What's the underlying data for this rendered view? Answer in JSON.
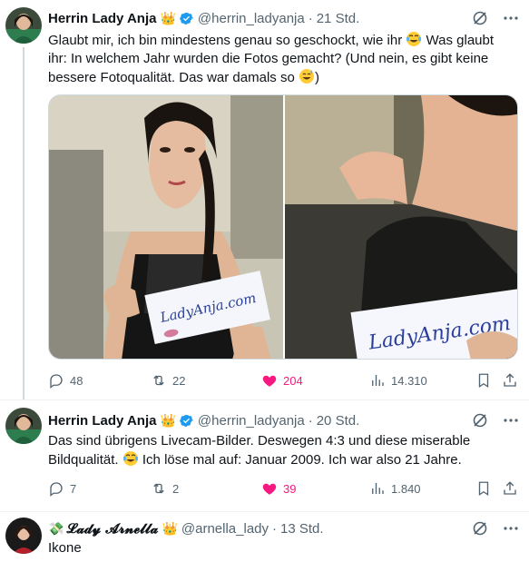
{
  "tweets": [
    {
      "author": "Herrin Lady Anja",
      "crown": "👑",
      "handle": "@herrin_ladyanja",
      "dot": "·",
      "time": "21 Std.",
      "text_part1": "Glaubt mir, ich bin mindestens genau so geschockt, wie ihr ",
      "text_part2": " Was glaubt ihr: In welchem Jahr wurden die Fotos gemacht? (Und nein, es gibt keine bessere Fotoqualität. Das war damals so ",
      "text_part3": ")",
      "media": [
        {
          "alt_icon": "photo-woman-with-ladyanja-sign-1",
          "sign_text": "LadyAnja.com"
        },
        {
          "alt_icon": "photo-woman-with-ladyanja-sign-2",
          "sign_text": "LadyAnja.com"
        }
      ],
      "replies": "48",
      "reposts": "22",
      "likes": "204",
      "views": "14.310"
    },
    {
      "author": "Herrin Lady Anja",
      "crown": "👑",
      "handle": "@herrin_ladyanja",
      "dot": "·",
      "time": "20 Std.",
      "text_part1": "Das sind übrigens Livecam-Bilder. Deswegen 4:3 und diese miserable Bildqualität. ",
      "text_part2": " Ich löse mal auf: Januar 2009. Ich war also 21 Jahre.",
      "replies": "7",
      "reposts": "2",
      "likes": "39",
      "views": "1.840"
    },
    {
      "author_prefix": "💸",
      "author": "𝓛𝓪𝓭𝔂 𝓐𝓻𝓷𝓮𝓵𝓵𝓪",
      "crown": "👑",
      "handle": "@arnella_lady",
      "dot": "·",
      "time": "13 Std.",
      "text": "Ikone"
    }
  ],
  "colors": {
    "verified": "#1d9bf0",
    "like": "#f91880",
    "muted": "#536471",
    "thread_line": "#cfd9de"
  },
  "icons": [
    "grok-icon",
    "more-icon",
    "reply-icon",
    "repost-icon",
    "like-icon",
    "views-icon",
    "bookmark-icon",
    "share-icon",
    "verified-icon"
  ]
}
